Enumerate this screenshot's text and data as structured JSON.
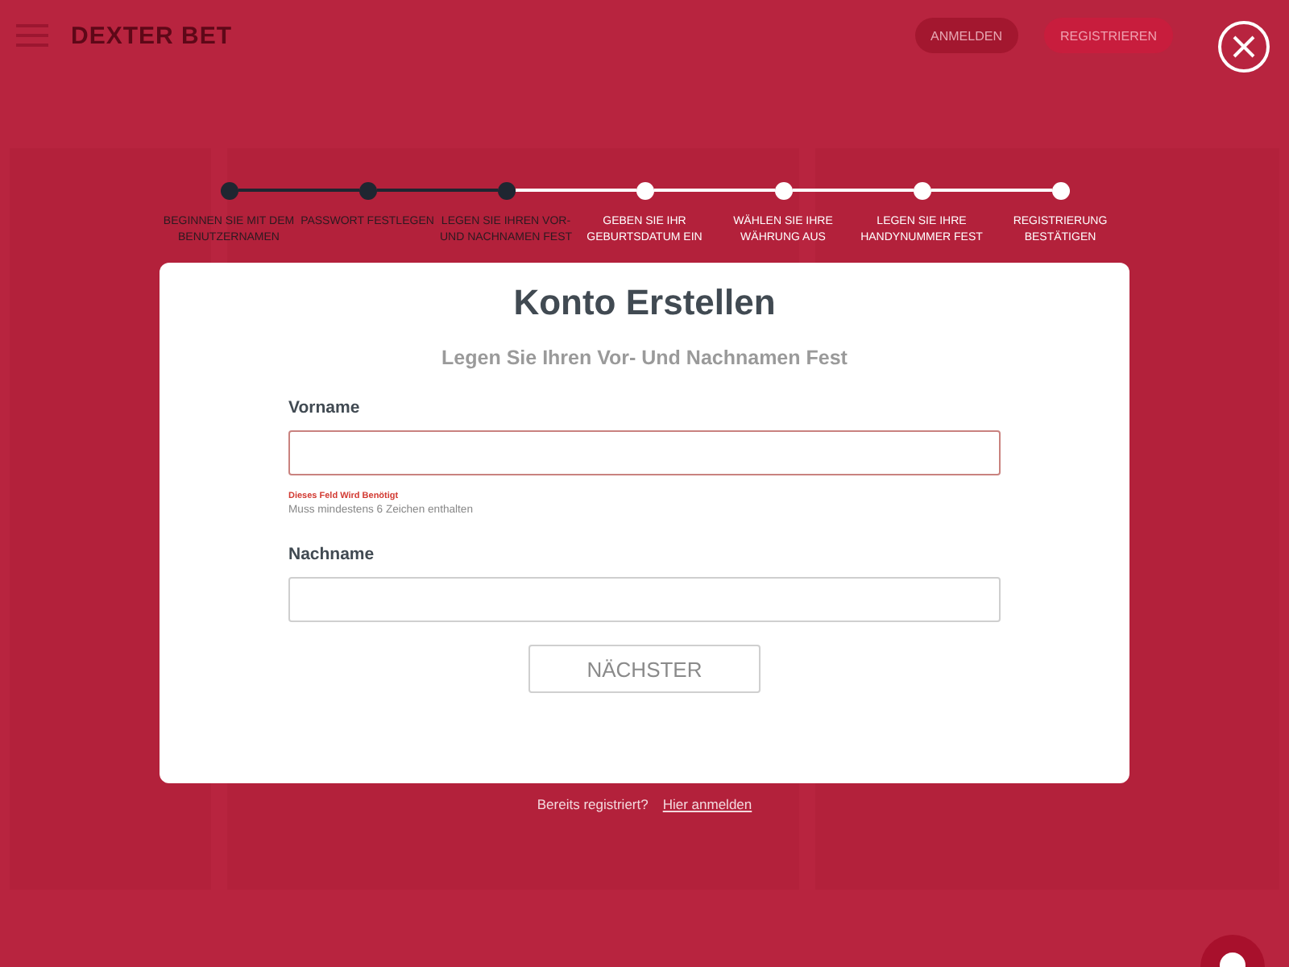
{
  "header": {
    "logo": "DEXTER BET",
    "buttons": [
      "ANMELDEN",
      "REGISTRIEREN"
    ]
  },
  "steps": [
    {
      "label": "BEGINNEN SIE MIT DEM BENUTZERNAMEN",
      "done": true
    },
    {
      "label": "PASSWORT FESTLEGEN",
      "done": true
    },
    {
      "label": "LEGEN SIE IHREN VOR- UND NACHNAMEN FEST",
      "done": true
    },
    {
      "label": "GEBEN SIE IHR GEBURTSDATUM EIN",
      "done": false
    },
    {
      "label": "WÄHLEN SIE IHRE WÄHRUNG AUS",
      "done": false
    },
    {
      "label": "LEGEN SIE IHRE HANDYNUMMER FEST",
      "done": false
    },
    {
      "label": "REGISTRIERUNG BESTÄTIGEN",
      "done": false
    }
  ],
  "modal": {
    "title": "Konto Erstellen",
    "subtitle": "Legen Sie Ihren Vor- Und Nachnamen Fest",
    "fields": [
      {
        "label": "Vorname",
        "invalid": true,
        "error": "Dieses Feld Wird Benötigt",
        "hint": "Muss mindestens 6 Zeichen enthalten"
      },
      {
        "label": "Nachname",
        "invalid": false
      }
    ],
    "button": "NÄCHSTER"
  },
  "footer": {
    "text": "Bereits registriert?",
    "link": "Hier anmelden"
  }
}
